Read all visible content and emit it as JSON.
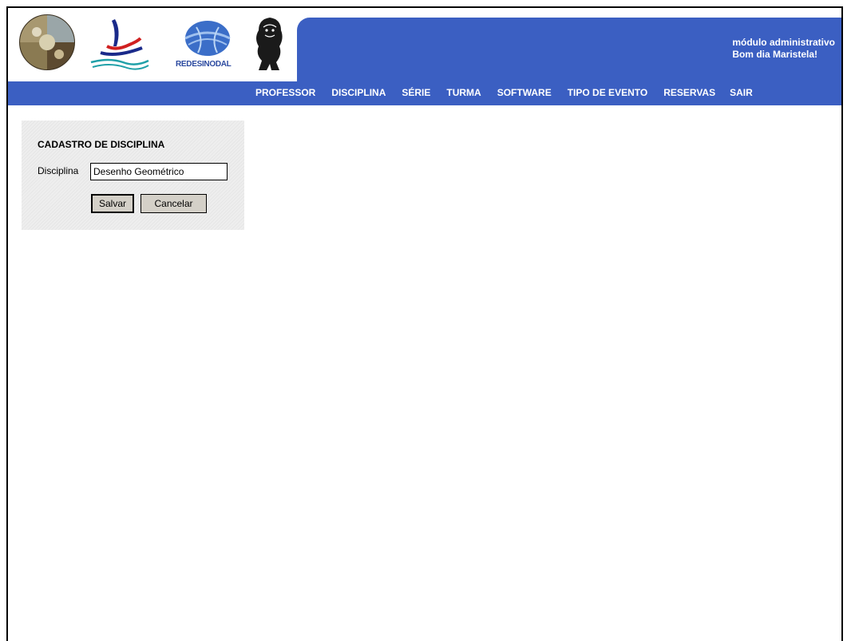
{
  "header": {
    "module_label": "módulo administrativo",
    "greeting": "Bom dia Maristela!",
    "brand_text": "REDESINODAL",
    "accent_color": "#3b5fc2"
  },
  "nav": {
    "items": [
      "PROFESSOR",
      "DISCIPLINA",
      "SÉRIE",
      "TURMA",
      "SOFTWARE",
      "TIPO DE EVENTO",
      "RESERVAS",
      "SAIR"
    ]
  },
  "form": {
    "title": "CADASTRO DE DISCIPLINA",
    "field_label": "Disciplina",
    "field_value": "Desenho Geométrico",
    "save_label": "Salvar",
    "cancel_label": "Cancelar"
  }
}
